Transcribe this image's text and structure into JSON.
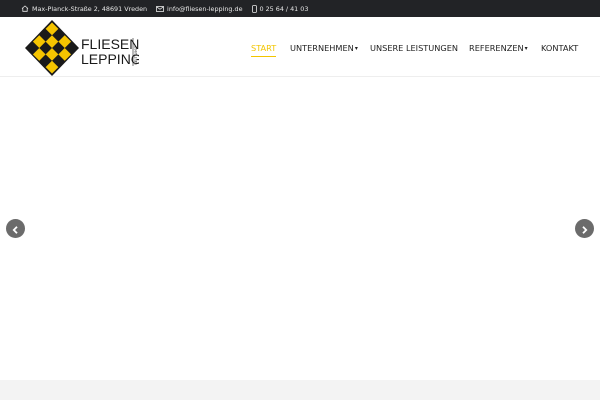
{
  "topbar": {
    "address": "Max-Planck-Straße 2, 48691 Vreden",
    "email": "info@fliesen-lepping.de",
    "phone": "0 25 64 / 41 03",
    "icons": {
      "address": "home-icon",
      "email": "envelope-icon",
      "phone": "phone-icon"
    }
  },
  "logo": {
    "line1": "FLIESEN",
    "line2": "LEPPING",
    "since": "SEIT 1967",
    "colors": {
      "yellow": "#f5c400",
      "black": "#1a1a1a"
    }
  },
  "nav": {
    "items": [
      {
        "label": "START",
        "active": true,
        "dropdown": false
      },
      {
        "label": "UNTERNEHMEN",
        "active": false,
        "dropdown": true
      },
      {
        "label": "UNSERE LEISTUNGEN",
        "active": false,
        "dropdown": false
      },
      {
        "label": "REFERENZEN",
        "active": false,
        "dropdown": true
      },
      {
        "label": "KONTAKT",
        "active": false,
        "dropdown": false
      }
    ]
  },
  "slider": {
    "prev_icon": "chevron-left-icon",
    "next_icon": "chevron-right-icon"
  },
  "colors": {
    "accent": "#f2c500",
    "topbar_bg": "#222326",
    "arrow_bg": "#6b6b6b"
  }
}
